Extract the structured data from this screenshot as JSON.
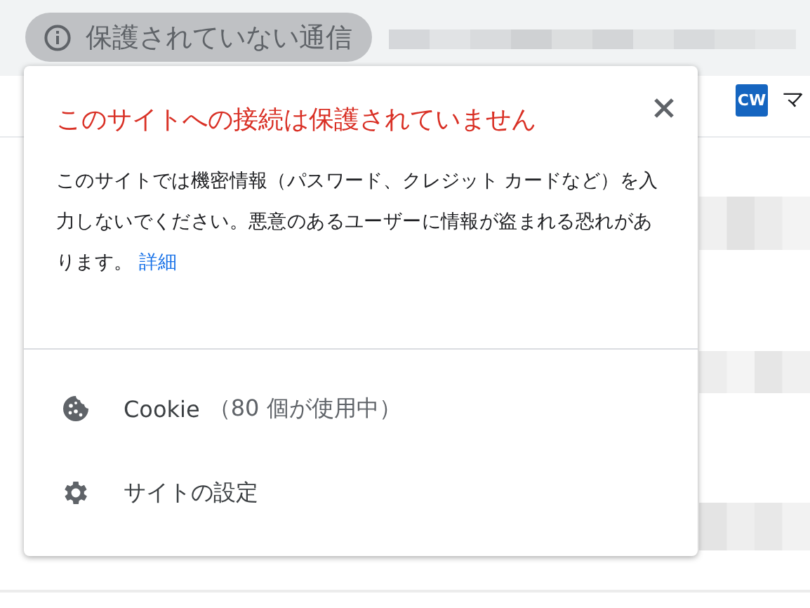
{
  "address_bar": {
    "security_chip": "保護されていない通信"
  },
  "bookmarks": [
    {
      "icon_text": "CW",
      "label": "マ"
    }
  ],
  "popup": {
    "title": "このサイトへの接続は保護されていません",
    "message": "このサイトでは機密情報（パスワード、クレジット カードなど）を入力しないでください。悪意のあるユーザーに情報が盗まれる恐れがあります。",
    "link": "詳細",
    "items": [
      {
        "kind": "cookie",
        "label": "Cookie",
        "detail": "（80 個が使用中）"
      },
      {
        "kind": "settings",
        "label": "サイトの設定"
      }
    ]
  }
}
